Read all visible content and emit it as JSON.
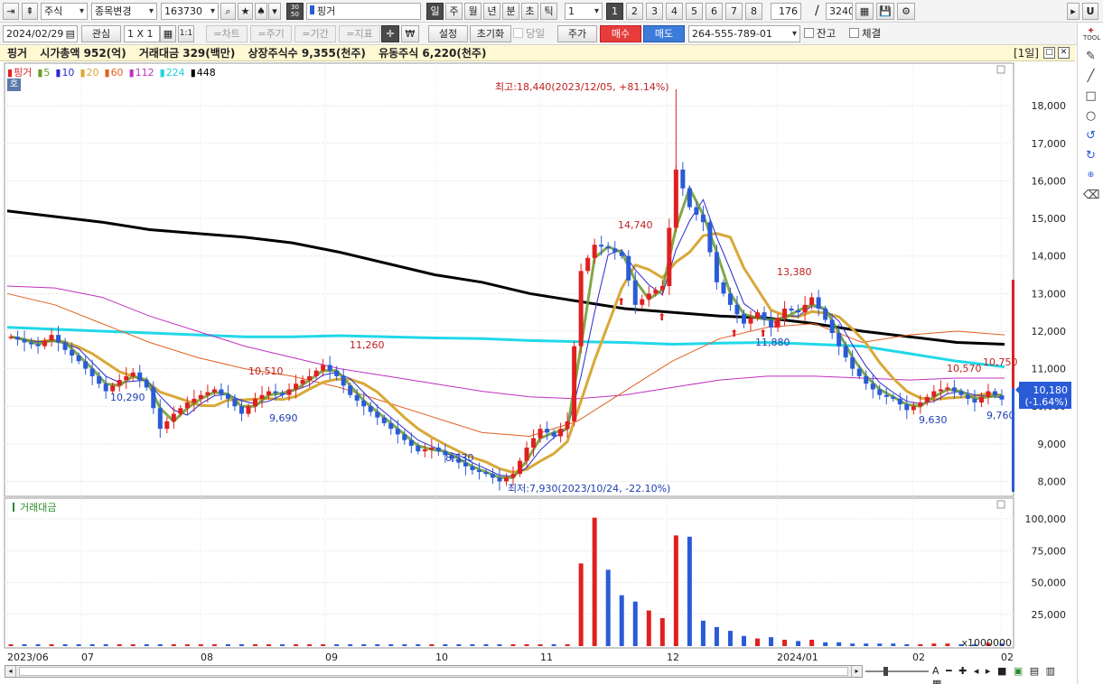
{
  "toolbar1": {
    "market": "주식",
    "change_label": "종목변경",
    "code": "163730",
    "period_box": "30\n50",
    "stock_name": "핑거",
    "period_tabs": [
      "일",
      "주",
      "월",
      "년",
      "분",
      "초",
      "틱"
    ],
    "interval": "1",
    "multi_tabs": [
      "1",
      "2",
      "3",
      "4",
      "5",
      "6",
      "7",
      "8"
    ],
    "count": "176",
    "total": "3240",
    "slash": "/",
    "u_label": "U"
  },
  "toolbar2": {
    "date": "2024/02/29",
    "interest": "관심",
    "layout": "1 X 1",
    "one_one": "1:1",
    "chart_btn": "=차트",
    "period_btn": "=주기",
    "range_btn": "=기간",
    "indicator_btn": "=지표",
    "won": "₩",
    "settings": "설정",
    "reset": "초기화",
    "today": "당일",
    "price": "주가",
    "buy": "매수",
    "sell": "매도",
    "account": "264-555-789-01",
    "balance": "잔고",
    "fill": "체결"
  },
  "info_bar": {
    "name": "핑거",
    "market_cap": "시가총액 952(억)",
    "trade_value": "거래대금 329(백만)",
    "listed": "상장주식수 9,355(천주)",
    "float": "유동주식 6,220(천주)",
    "period_label": "[1일]"
  },
  "legend": {
    "items": [
      {
        "label": "핑거",
        "color": "#e02020"
      },
      {
        "label": "5",
        "color": "#6a9a2a"
      },
      {
        "label": "10",
        "color": "#2a2ad0"
      },
      {
        "label": "20",
        "color": "#d8a838"
      },
      {
        "label": "60",
        "color": "#e06020"
      },
      {
        "label": "112",
        "color": "#c030c0"
      },
      {
        "label": "224",
        "color": "#20d0e0"
      },
      {
        "label": "448",
        "color": "#000000"
      }
    ],
    "ho": "호"
  },
  "price_chart": {
    "yticks": [
      "18,000",
      "17,000",
      "16,000",
      "15,000",
      "14,000",
      "13,000",
      "12,000",
      "11,000",
      "10,000",
      "9,000",
      "8,000"
    ],
    "high_label": "최고:18,440(2023/12/05, +81.14%)",
    "low_label": "최저:7,930(2023/10/24, -22.10%)",
    "annotations": [
      {
        "text": "10,290",
        "color": "#2040b0"
      },
      {
        "text": "10,510",
        "color": "#c02020"
      },
      {
        "text": "9,690",
        "color": "#2040b0"
      },
      {
        "text": "11,260",
        "color": "#c02020"
      },
      {
        "text": "8,530",
        "color": "#2040b0"
      },
      {
        "text": "14,740",
        "color": "#c02020"
      },
      {
        "text": "13,380",
        "color": "#c02020"
      },
      {
        "text": "11,880",
        "color": "#2040b0"
      },
      {
        "text": "10,570",
        "color": "#c02020"
      },
      {
        "text": "10,750",
        "color": "#c02020"
      },
      {
        "text": "9,630",
        "color": "#2040b0"
      },
      {
        "text": "9,760",
        "color": "#2040b0"
      }
    ],
    "current_price": "10,180",
    "current_change": "(-1.64%)"
  },
  "volume_chart": {
    "label": "거래대금",
    "yticks": [
      "100,000",
      "75,000",
      "50,000",
      "25,000"
    ],
    "unit": "x1000000"
  },
  "x_axis": {
    "labels": [
      "2023/06",
      "07",
      "08",
      "09",
      "10",
      "11",
      "12",
      "2024/01",
      "02",
      "02"
    ]
  },
  "chart_data": {
    "type": "candlestick",
    "title": "핑거",
    "y_range": [
      7700,
      18700
    ],
    "volume_range": [
      0,
      105000
    ],
    "volume_unit": "x1000000",
    "x_range": [
      "2023/06",
      "2024/02"
    ],
    "moving_averages": [
      5,
      10,
      20,
      60,
      112,
      224,
      448
    ],
    "high": {
      "value": 18440,
      "date": "2023/12/05",
      "pct": 81.14
    },
    "low": {
      "value": 7930,
      "date": "2023/10/24",
      "pct": -22.1
    },
    "last_close": 10180,
    "last_change_pct": -1.64,
    "close_path": [
      11850,
      11700,
      11600,
      11900,
      11500,
      11200,
      10800,
      10400,
      10700,
      10900,
      10500,
      9400,
      9800,
      10100,
      10300,
      10450,
      10200,
      9800,
      10200,
      10400,
      10300,
      10600,
      10800,
      11100,
      10800,
      10300,
      10000,
      9700,
      9400,
      9100,
      8800,
      8900,
      8700,
      8500,
      8300,
      8200,
      8000,
      8200,
      8900,
      9400,
      9200,
      9600,
      13600,
      14300,
      14200,
      14000,
      12700,
      13000,
      13200,
      16300,
      15300,
      14900,
      13300,
      12700,
      12200,
      12500,
      12100,
      12600,
      12500,
      12900,
      12300,
      11600,
      11000,
      10600,
      10300,
      10200,
      9900,
      10100,
      10400,
      10500,
      10300,
      10100,
      10400,
      10180
    ],
    "ma448_path": [
      15200,
      15050,
      14900,
      14700,
      14600,
      14500,
      14350,
      14100,
      13800,
      13500,
      13300,
      13000,
      12800,
      12600,
      12500,
      12400,
      12350,
      12200,
      12000,
      11850,
      11700,
      11650
    ],
    "ma224_path": [
      12100,
      12050,
      12000,
      11950,
      11900,
      11850,
      11850,
      11880,
      11850,
      11820,
      11800,
      11750,
      11720,
      11700,
      11650,
      11680,
      11700,
      11650,
      11600,
      11400,
      11200,
      11050
    ],
    "ma112_path": [
      13200,
      13150,
      12900,
      12400,
      12000,
      11600,
      11300,
      11000,
      10800,
      10600,
      10400,
      10250,
      10200,
      10300,
      10500,
      10700,
      10800,
      10800,
      10750,
      10700,
      10750,
      10750
    ],
    "ma60_path": [
      13000,
      12700,
      12200,
      11700,
      11300,
      11000,
      10800,
      10500,
      10100,
      9700,
      9300,
      9200,
      9600,
      10400,
      11200,
      11800,
      12100,
      12200,
      11700,
      11900,
      12000,
      11900
    ],
    "volume": [
      2,
      1,
      1,
      1,
      2,
      1,
      1,
      1,
      1,
      2,
      1,
      1,
      1,
      1,
      1,
      2,
      1,
      1,
      1,
      1,
      1,
      1,
      1,
      1,
      1,
      1,
      1,
      1,
      1,
      1,
      1,
      1,
      1,
      1,
      1,
      1,
      1,
      1,
      2,
      2,
      1,
      1,
      65000,
      101000,
      60000,
      40000,
      35000,
      28000,
      22000,
      87000,
      86000,
      20000,
      15000,
      12000,
      8000,
      6000,
      7000,
      5000,
      4000,
      5000,
      3000,
      3000,
      2000,
      2000,
      2000,
      2000,
      1500,
      1500,
      2000,
      2000,
      1500,
      1500,
      2500,
      2000
    ]
  }
}
